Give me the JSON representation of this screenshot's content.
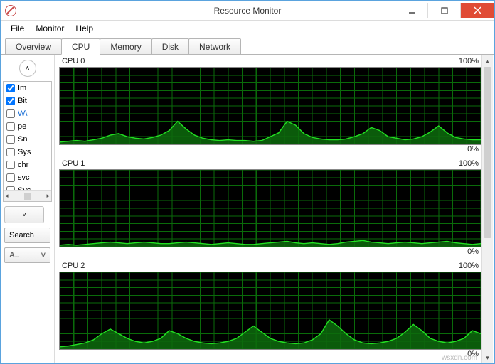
{
  "window": {
    "title": "Resource Monitor"
  },
  "menubar": [
    "File",
    "Monitor",
    "Help"
  ],
  "tabs": [
    {
      "label": "Overview",
      "active": false
    },
    {
      "label": "CPU",
      "active": true
    },
    {
      "label": "Memory",
      "active": false
    },
    {
      "label": "Disk",
      "active": false
    },
    {
      "label": "Network",
      "active": false
    }
  ],
  "process_list": [
    {
      "label": "Im",
      "checked": true
    },
    {
      "label": "Bit",
      "checked": true
    },
    {
      "label": "W\\",
      "checked": false,
      "selected": true
    },
    {
      "label": "pe",
      "checked": false
    },
    {
      "label": "Sn",
      "checked": false
    },
    {
      "label": "Sys",
      "checked": false
    },
    {
      "label": "chr",
      "checked": false
    },
    {
      "label": "svc",
      "checked": false
    },
    {
      "label": "Sys",
      "checked": false
    }
  ],
  "search_button": "Search",
  "associated_button": "A..",
  "chart_data": [
    {
      "type": "area",
      "title": "CPU 0",
      "ylabel_top": "100%",
      "ylabel_bottom": "0%",
      "ylim": [
        0,
        100
      ],
      "x": [
        0,
        2,
        4,
        6,
        8,
        10,
        12,
        14,
        16,
        18,
        20,
        22,
        24,
        26,
        28,
        30,
        32,
        34,
        36,
        38,
        40,
        42,
        44,
        46,
        48,
        50,
        52,
        54,
        56,
        58,
        60,
        62,
        64,
        66,
        68,
        70,
        72,
        74,
        76,
        78,
        80,
        82,
        84,
        86,
        88,
        90,
        92,
        94,
        96,
        98,
        100
      ],
      "values": [
        3,
        4,
        5,
        4,
        6,
        8,
        12,
        14,
        10,
        8,
        7,
        9,
        12,
        18,
        30,
        20,
        12,
        8,
        6,
        5,
        6,
        5,
        5,
        4,
        5,
        10,
        15,
        30,
        25,
        14,
        9,
        7,
        6,
        6,
        7,
        10,
        14,
        22,
        18,
        10,
        8,
        6,
        7,
        10,
        16,
        24,
        15,
        9,
        7,
        6,
        6
      ]
    },
    {
      "type": "area",
      "title": "CPU 1",
      "ylabel_top": "100%",
      "ylabel_bottom": "0%",
      "ylim": [
        0,
        100
      ],
      "x": [
        0,
        2,
        4,
        6,
        8,
        10,
        12,
        14,
        16,
        18,
        20,
        22,
        24,
        26,
        28,
        30,
        32,
        34,
        36,
        38,
        40,
        42,
        44,
        46,
        48,
        50,
        52,
        54,
        56,
        58,
        60,
        62,
        64,
        66,
        68,
        70,
        72,
        74,
        76,
        78,
        80,
        82,
        84,
        86,
        88,
        90,
        92,
        94,
        96,
        98,
        100
      ],
      "values": [
        2,
        3,
        2,
        3,
        4,
        5,
        6,
        5,
        4,
        5,
        6,
        5,
        4,
        4,
        5,
        6,
        5,
        4,
        3,
        4,
        5,
        4,
        3,
        3,
        4,
        5,
        6,
        7,
        5,
        4,
        5,
        4,
        3,
        4,
        6,
        7,
        8,
        6,
        5,
        4,
        5,
        6,
        5,
        4,
        5,
        6,
        7,
        5,
        4,
        3,
        4
      ]
    },
    {
      "type": "area",
      "title": "CPU 2",
      "ylabel_top": "100%",
      "ylabel_bottom": "0%",
      "ylim": [
        0,
        100
      ],
      "x": [
        0,
        2,
        4,
        6,
        8,
        10,
        12,
        14,
        16,
        18,
        20,
        22,
        24,
        26,
        28,
        30,
        32,
        34,
        36,
        38,
        40,
        42,
        44,
        46,
        48,
        50,
        52,
        54,
        56,
        58,
        60,
        62,
        64,
        66,
        68,
        70,
        72,
        74,
        76,
        78,
        80,
        82,
        84,
        86,
        88,
        90,
        92,
        94,
        96,
        98,
        100
      ],
      "values": [
        3,
        4,
        6,
        8,
        12,
        20,
        26,
        20,
        14,
        10,
        8,
        10,
        14,
        24,
        20,
        14,
        10,
        8,
        7,
        8,
        10,
        14,
        22,
        30,
        22,
        14,
        10,
        8,
        7,
        8,
        12,
        20,
        38,
        30,
        20,
        12,
        8,
        7,
        8,
        10,
        14,
        22,
        32,
        24,
        14,
        10,
        8,
        10,
        14,
        24,
        20
      ]
    }
  ],
  "watermark": "wsxdn.com"
}
